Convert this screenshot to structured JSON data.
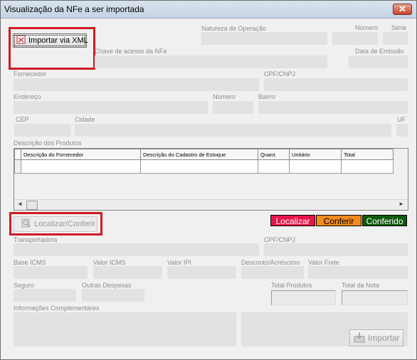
{
  "window": {
    "title": "Visualização da NFe a ser importada",
    "close_glyph": "✕"
  },
  "buttons": {
    "importar_xml": "Importar via XML",
    "localizar_conferir": "Localizar/Conferir",
    "importar": "Importar"
  },
  "labels": {
    "natureza": "Natureza de Operação",
    "numero": "Número",
    "serie": "Série",
    "chave": "Chave de acesso da NFe",
    "data_emissao": "Data de Emissão",
    "fornecedor": "Fornecedor",
    "cpf_cnpj": "CPF/CNPJ",
    "endereco": "Endereço",
    "numero_end": "Número",
    "bairro": "Bairro",
    "cep": "CEP",
    "cidade": "Cidade",
    "uf": "UF",
    "descricao_produtos": "Descrição dos Produtos",
    "transportadora": "Transportadora",
    "cpf_cnpj_transp": "CPF/CNPJ",
    "base_icms": "Base ICMS",
    "valor_icms": "Valor ICMS",
    "valor_ipi": "Valor IPI",
    "desconto": "Desconto/Acréscimo",
    "valor_frete": "Valor Frete",
    "seguro": "Seguro",
    "outras_despesas": "Outras Despesas",
    "total_produtos": "Total Produtos",
    "total_nota": "Total da Nota",
    "info_complementares": "Informações Complementares"
  },
  "grid": {
    "columns": [
      "Descrição do Fornecedor",
      "Descrição do Cadastro de Estoque",
      "Quant.",
      "Unitário",
      "Total"
    ]
  },
  "status_tags": {
    "localizar": {
      "label": "Localizar",
      "bg": "#e8154a",
      "fg": "#ffffff"
    },
    "conferir": {
      "label": "Conferir",
      "bg": "#f28a1e",
      "fg": "#000000"
    },
    "conferido": {
      "label": "Conferido",
      "bg": "#0d5a0d",
      "fg": "#ffffff"
    }
  },
  "colors": {
    "highlight": "#d01c24"
  }
}
